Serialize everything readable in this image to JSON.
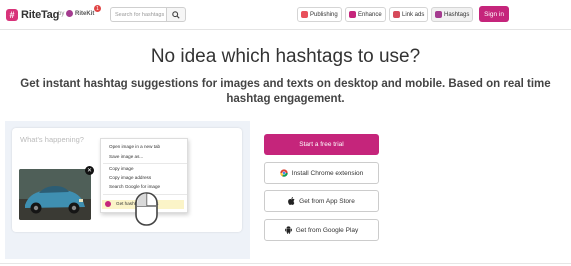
{
  "nav": {
    "logo_text": "RiteTag",
    "logo_mark": "#",
    "by_text": "by",
    "parent_brand": "RiteKit",
    "notification_count": "1",
    "search_placeholder": "Search for hashtags",
    "links": [
      {
        "label": "Publishing",
        "icon": "publishing-icon",
        "color": "#e8505b"
      },
      {
        "label": "Enhance",
        "icon": "enhance-icon",
        "color": "#c5257b"
      },
      {
        "label": "Link ads",
        "icon": "link-ads-icon",
        "color": "#d64a5a"
      },
      {
        "label": "Hashtags",
        "icon": "hashtags-icon",
        "color": "#a43b8f"
      }
    ],
    "signin_label": "Sign in"
  },
  "hero": {
    "headline": "No idea which hashtags to use?",
    "subline_1": "Get instant hashtag suggestions for images and texts on desktop and mobile. Based on real time",
    "subline_2": "hashtag engagement."
  },
  "demo": {
    "composer_placeholder": "What's happening?",
    "context_menu": [
      "Open image in a new tab",
      "Save image as...",
      "Copy image",
      "Copy image address",
      "Search Google for image"
    ],
    "context_menu_highlight": "Get hashtags for this"
  },
  "cta": {
    "trial": "Start a free trial",
    "chrome": "Install Chrome extension",
    "appstore": "Get from App Store",
    "googleplay": "Get from Google Play"
  },
  "colors": {
    "brand": "#c5257b",
    "demo_bg": "#eef2f8"
  }
}
